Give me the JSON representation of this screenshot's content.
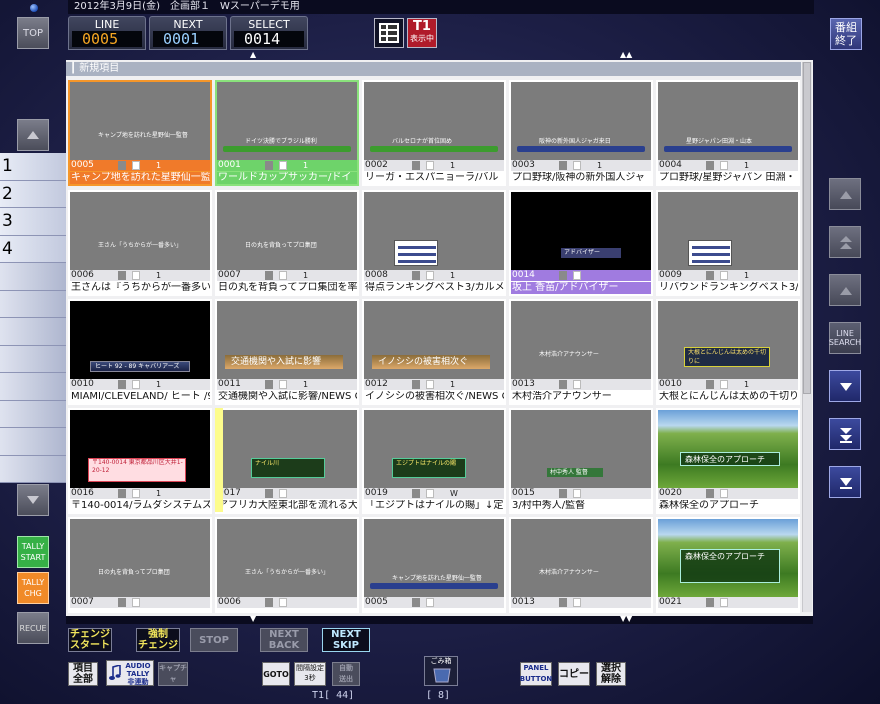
{
  "header": {
    "title": "2012年3月9日(金)　企画部１　Wスーパーデモ用",
    "top_button": "TOP",
    "counters": [
      {
        "label": "LINE",
        "value": "0005",
        "color": "#f5a623"
      },
      {
        "label": "NEXT",
        "value": "0001",
        "color": "#9ad0ff"
      },
      {
        "label": "SELECT",
        "value": "0014",
        "color": "#ffffff"
      }
    ],
    "t1_label": "T1",
    "t1_sub": "表示中",
    "end_button": "番組\n終了"
  },
  "panel": {
    "header_label": "新規項目",
    "scroll_marks": [
      "▲",
      "▲▲",
      "▼",
      "▼▼"
    ]
  },
  "tiles": [
    {
      "id": "0005",
      "num": "1",
      "caption": "キャンプ地を訪れた星野仙一監",
      "state": "orange",
      "sup": "キャンプ地を訪れた星野仙一監督",
      "band": ""
    },
    {
      "id": "0001",
      "num": "1",
      "caption": "ワールドカップサッカー/ドイ",
      "state": "green",
      "sup": "ドイツ決勝でブラジル勝利",
      "band": "#3c9c2e"
    },
    {
      "id": "0002",
      "num": "1",
      "caption": "リーガ・エスパニョーラ/バル",
      "state": "",
      "sup": "バルセロナが首位固め",
      "band": "#3c9c2e"
    },
    {
      "id": "0003",
      "num": "1",
      "caption": "プロ野球/阪神の新外国人ジャ",
      "state": "",
      "sup": "阪神の新外国人ジャガ来日",
      "band": "#2a3f8e"
    },
    {
      "id": "0004",
      "num": "1",
      "caption": "プロ野球/星野ジャパン 田淵・",
      "state": "",
      "sup": "星野ジャパン田淵・山本",
      "band": "#2a3f8e"
    },
    {
      "id": "0006",
      "num": "1",
      "caption": "王さんは『うちからが一番多い",
      "state": "",
      "sup": "王さん「うちからが一番多い」",
      "band": ""
    },
    {
      "id": "0007",
      "num": "1",
      "caption": "日の丸を背負ってプロ集団を率",
      "state": "",
      "sup": "日の丸を背負ってプロ集団",
      "band": ""
    },
    {
      "id": "0008",
      "num": "1",
      "caption": "得点ランキングベスト3/カルメ",
      "state": "",
      "sup": "得点ランキングベスト3",
      "band": "rank"
    },
    {
      "id": "0014",
      "num": "",
      "caption": "坂上 香苗/アドバイザー",
      "state": "purple",
      "sup": "アドバイザー",
      "band": "black"
    },
    {
      "id": "0009",
      "num": "1",
      "caption": "リバウンドランキングベスト3/",
      "state": "",
      "sup": "リバウンドランキングベスト3",
      "band": "rank"
    },
    {
      "id": "0010",
      "num": "1",
      "caption": "MIAMI/CLEVELAND/ ヒート /92/",
      "state": "",
      "sup": "ヒート 92 - 89 キャバリアーズ",
      "band": "score"
    },
    {
      "id": "0011",
      "num": "1",
      "caption": "交通機関や入試に影響/NEWS CL",
      "state": "",
      "sup": "交通機関や入試に影響",
      "band": "title"
    },
    {
      "id": "0012",
      "num": "1",
      "caption": "イノシシの被害相次ぐ/NEWS CL",
      "state": "",
      "sup": "イノシシの被害相次ぐ",
      "band": "title"
    },
    {
      "id": "0013",
      "num": "",
      "caption": "木村浩介アナウンサー",
      "state": "",
      "sup": "木村浩介アナウンサー",
      "band": ""
    },
    {
      "id": "0010",
      "num": "1",
      "caption": "大根とにんじんは太めの千切り",
      "state": "",
      "sup": "大根とにんじんは太めの千切りに",
      "band": "point"
    },
    {
      "id": "0016",
      "num": "1",
      "caption": "〒140-0014/ラムダシステムズ",
      "state": "",
      "sup": "〒140-0014 東京都品川区大井1-20-12",
      "band": "address"
    },
    {
      "id": "0017",
      "num": "",
      "caption": "アフリカ大陸東北部を流れる大",
      "state": "yellow",
      "sup": "ナイル川",
      "band": "nile"
    },
    {
      "id": "0019",
      "num": "W",
      "caption": "「エジプトはナイルの賜」↓定",
      "state": "",
      "sup": "エジプトはナイルの賜",
      "band": "nile"
    },
    {
      "id": "0015",
      "num": "",
      "caption": "3/村中秀人/監督",
      "state": "",
      "sup": "村中秀人 監督",
      "band": "coach"
    },
    {
      "id": "0020",
      "num": "",
      "caption": "森林保全のアプローチ",
      "state": "",
      "sup": "森林保全のアプローチ",
      "band": "forest"
    },
    {
      "id": "0007",
      "num": "",
      "caption": "",
      "state": "",
      "sup": "日の丸を背負ってプロ集団",
      "band": ""
    },
    {
      "id": "0006",
      "num": "",
      "caption": "",
      "state": "",
      "sup": "王さん「うちからが一番多い」",
      "band": ""
    },
    {
      "id": "0005",
      "num": "",
      "caption": "",
      "state": "",
      "sup": "キャンプ地を訪れた星野仙一監督",
      "band": "#2a3f8e"
    },
    {
      "id": "0013",
      "num": "",
      "caption": "",
      "state": "",
      "sup": "木村浩介アナウンサー",
      "band": ""
    },
    {
      "id": "0021",
      "num": "",
      "caption": "",
      "state": "",
      "sup": "森林保全のアプローチ",
      "band": "forest2"
    }
  ],
  "left": {
    "line_numbers": [
      "1",
      "2",
      "3",
      "4",
      "",
      "",
      "",
      "",
      "",
      "",
      "",
      ""
    ],
    "tally_start": "TALLY\nSTART",
    "tally_chg": "TALLY\nCHG",
    "recue": "RECUE"
  },
  "right": {
    "line_search": "LINE\nSEARCH"
  },
  "bottom": {
    "change_start": "チェンジ\nスタート",
    "forced_change": "強制\nチェンジ",
    "stop": "STOP",
    "next_back": "NEXT\nBACK",
    "next_skip": "NEXT\nSKIP",
    "all_items": "項目\n全部",
    "audio_tally": "AUDIO\nTALLY\n非連動",
    "capture": "キャプチャ",
    "goto": "GOTO",
    "interval_label": "間隔設定",
    "interval_value": "3秒",
    "auto_feed": "自動\n送出",
    "trash_label": "ごみ箱",
    "panel_button": "PANEL\nBUTTON",
    "copy": "コピー",
    "deselect": "選択\n解除",
    "status_left": "T1[    44]",
    "status_right": "[    8]"
  }
}
